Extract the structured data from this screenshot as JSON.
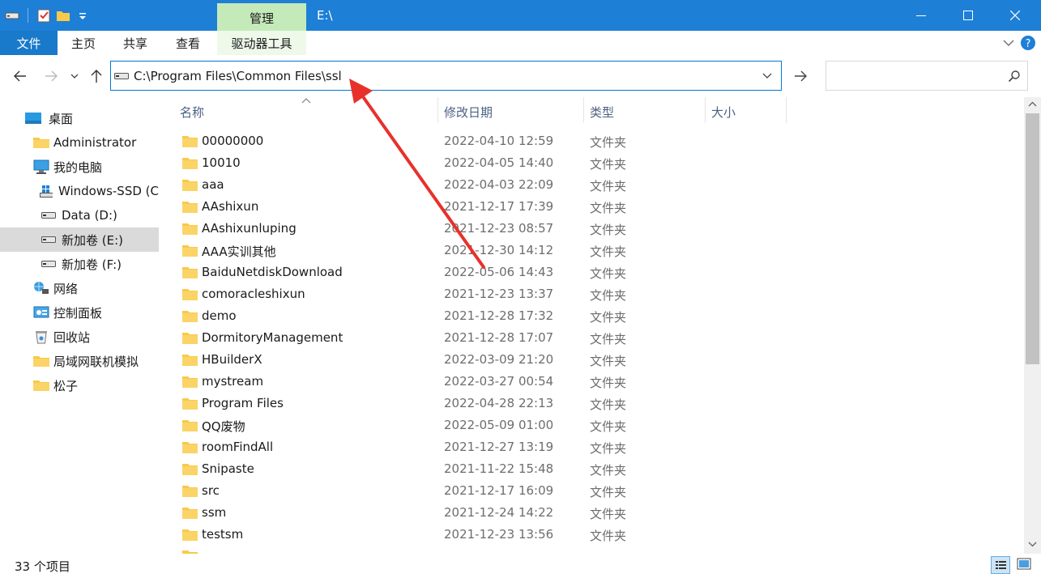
{
  "titlebar": {
    "contextual_tab": "管理",
    "window_title": "E:\\",
    "minimize": "—",
    "maximize": "☐",
    "close": "✕"
  },
  "ribbon": {
    "tabs": [
      "文件",
      "主页",
      "共享",
      "查看",
      "驱动器工具"
    ],
    "expand_glyph": "⌄",
    "help_glyph": "?"
  },
  "navigation": {
    "address": "C:\\Program Files\\Common Files\\ssl",
    "search_placeholder": ""
  },
  "sidebar": {
    "items": [
      {
        "label": "桌面",
        "icon": "desktop-icon"
      },
      {
        "label": "Administrator",
        "icon": "folder-icon"
      },
      {
        "label": "我的电脑",
        "icon": "computer-icon"
      },
      {
        "label": "Windows-SSD (C",
        "icon": "windows-drive-icon"
      },
      {
        "label": "Data (D:)",
        "icon": "drive-icon"
      },
      {
        "label": "新加卷 (E:)",
        "icon": "drive-icon"
      },
      {
        "label": "新加卷 (F:)",
        "icon": "drive-icon"
      },
      {
        "label": "网络",
        "icon": "network-icon"
      },
      {
        "label": "控制面板",
        "icon": "control-panel-icon"
      },
      {
        "label": "回收站",
        "icon": "recycle-bin-icon"
      },
      {
        "label": "局域网联机模拟",
        "icon": "folder-icon"
      },
      {
        "label": "松子",
        "icon": "folder-icon"
      }
    ]
  },
  "file_list": {
    "columns": [
      "名称",
      "修改日期",
      "类型",
      "大小"
    ],
    "rows": [
      {
        "name": "00000000",
        "date": "2022-04-10 12:59",
        "type": "文件夹"
      },
      {
        "name": "10010",
        "date": "2022-04-05 14:40",
        "type": "文件夹"
      },
      {
        "name": "aaa",
        "date": "2022-04-03 22:09",
        "type": "文件夹"
      },
      {
        "name": "AAshixun",
        "date": "2021-12-17 17:39",
        "type": "文件夹"
      },
      {
        "name": "AAshixunluping",
        "date": "2021-12-23 08:57",
        "type": "文件夹"
      },
      {
        "name": "AAA实训其他",
        "date": "2021-12-30 14:12",
        "type": "文件夹"
      },
      {
        "name": "BaiduNetdiskDownload",
        "date": "2022-05-06 14:43",
        "type": "文件夹"
      },
      {
        "name": "comoracleshixun",
        "date": "2021-12-23 13:37",
        "type": "文件夹"
      },
      {
        "name": "demo",
        "date": "2021-12-28 17:32",
        "type": "文件夹"
      },
      {
        "name": "DormitoryManagement",
        "date": "2021-12-28 17:07",
        "type": "文件夹"
      },
      {
        "name": "HBuilderX",
        "date": "2022-03-09 21:20",
        "type": "文件夹"
      },
      {
        "name": "mystream",
        "date": "2022-03-27 00:54",
        "type": "文件夹"
      },
      {
        "name": "Program Files",
        "date": "2022-04-28 22:13",
        "type": "文件夹"
      },
      {
        "name": "QQ废物",
        "date": "2022-05-09 01:00",
        "type": "文件夹"
      },
      {
        "name": "roomFindAll",
        "date": "2021-12-27 13:19",
        "type": "文件夹"
      },
      {
        "name": "Snipaste",
        "date": "2021-11-22 15:48",
        "type": "文件夹"
      },
      {
        "name": "src",
        "date": "2021-12-17 16:09",
        "type": "文件夹"
      },
      {
        "name": "ssm",
        "date": "2021-12-24 14:22",
        "type": "文件夹"
      },
      {
        "name": "testsm",
        "date": "2021-12-23 13:56",
        "type": "文件夹"
      }
    ]
  },
  "status": {
    "item_count": "33 个项目"
  },
  "colors": {
    "titlebar": "#1e7fd6",
    "file_tab": "#1979ca",
    "manage_tab": "#c5eab9",
    "accent_border": "#0078d7",
    "folder": "#f8c94a",
    "annotation_arrow": "#e8312b"
  }
}
